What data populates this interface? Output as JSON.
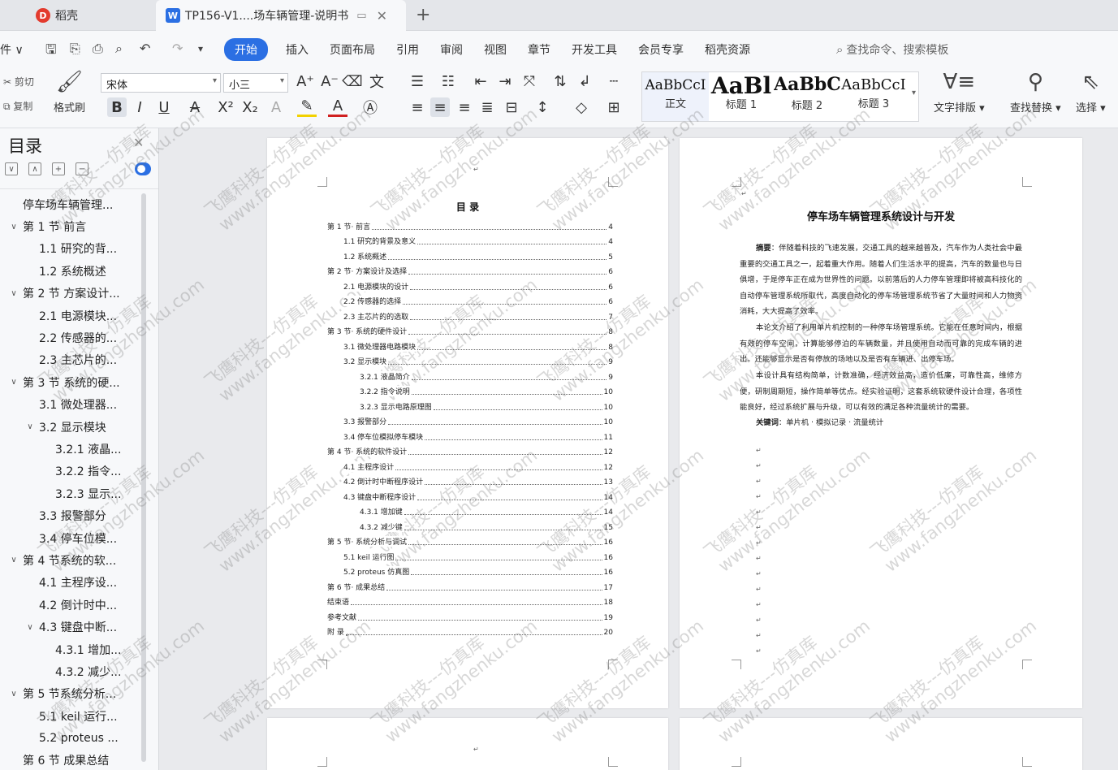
{
  "tabs": {
    "home": "稻壳",
    "home_icon": "docer-logo-icon",
    "doc": "TP156-V1....场车辆管理-说明书",
    "doc_icon": "wps-writer-icon",
    "add": "+"
  },
  "menubar": {
    "file": "件 ∨",
    "tabs": [
      "开始",
      "插入",
      "页面布局",
      "引用",
      "审阅",
      "视图",
      "章节",
      "开发工具",
      "会员专享",
      "稻壳资源"
    ],
    "search": "查找命令、搜索模板"
  },
  "ribbon": {
    "cut": "剪切",
    "copy": "复制",
    "format_painter": "格式刷",
    "font": "宋体",
    "size": "小三",
    "styles": [
      {
        "sample": "AaBbCcI",
        "name": "正文"
      },
      {
        "sample": "AaBl",
        "name": "标题 1"
      },
      {
        "sample": "AaBbC",
        "name": "标题 2"
      },
      {
        "sample": "AaBbCcI",
        "name": "标题 3"
      }
    ],
    "text_layout": "文字排版",
    "find_replace": "查找替换",
    "select": "选择"
  },
  "sidebar": {
    "title": "目录",
    "items": [
      {
        "label": "停车场车辆管理...",
        "level": 0,
        "chev": ""
      },
      {
        "label": "第 1 节  前言",
        "level": 0,
        "chev": "∨"
      },
      {
        "label": "1.1 研究的背...",
        "level": 1,
        "chev": ""
      },
      {
        "label": "1.2 系统概述",
        "level": 1,
        "chev": ""
      },
      {
        "label": "第 2 节  方案设计...",
        "level": 0,
        "chev": "∨"
      },
      {
        "label": "2.1 电源模块...",
        "level": 1,
        "chev": ""
      },
      {
        "label": "2.2 传感器的...",
        "level": 1,
        "chev": ""
      },
      {
        "label": "2.3 主芯片的...",
        "level": 1,
        "chev": ""
      },
      {
        "label": "第 3 节  系统的硬...",
        "level": 0,
        "chev": "∨"
      },
      {
        "label": "3.1 微处理器...",
        "level": 1,
        "chev": ""
      },
      {
        "label": "3.2 显示模块",
        "level": 1,
        "chev": "∨"
      },
      {
        "label": "3.2.1 液晶...",
        "level": 2,
        "chev": ""
      },
      {
        "label": "3.2.2 指令...",
        "level": 2,
        "chev": ""
      },
      {
        "label": "3.2.3 显示...",
        "level": 2,
        "chev": ""
      },
      {
        "label": "3.3 报警部分",
        "level": 1,
        "chev": ""
      },
      {
        "label": "3.4 停车位模...",
        "level": 1,
        "chev": ""
      },
      {
        "label": "第 4 节系统的软...",
        "level": 0,
        "chev": "∨"
      },
      {
        "label": "4.1 主程序设...",
        "level": 1,
        "chev": ""
      },
      {
        "label": "4.2 倒计时中...",
        "level": 1,
        "chev": ""
      },
      {
        "label": "4.3 键盘中断...",
        "level": 1,
        "chev": "∨"
      },
      {
        "label": "4.3.1 增加...",
        "level": 2,
        "chev": ""
      },
      {
        "label": "4.3.2 减少...",
        "level": 2,
        "chev": ""
      },
      {
        "label": "第 5 节系统分析...",
        "level": 0,
        "chev": "∨"
      },
      {
        "label": "5.1 keil 运行...",
        "level": 1,
        "chev": ""
      },
      {
        "label": "5.2 proteus ...",
        "level": 1,
        "chev": ""
      },
      {
        "label": "第 6 节  成果总结",
        "level": 0,
        "chev": ""
      }
    ]
  },
  "page1": {
    "heading": "目  录",
    "rows": [
      {
        "t": "第 1 节· 前言",
        "n": "4",
        "indent": 0
      },
      {
        "t": "1.1 研究的背景及意义",
        "n": "4",
        "indent": 1
      },
      {
        "t": "1.2 系统概述",
        "n": "5",
        "indent": 1
      },
      {
        "t": "第 2 节· 方案设计及选择",
        "n": "6",
        "indent": 0
      },
      {
        "t": "2.1 电源模块的设计",
        "n": "6",
        "indent": 1
      },
      {
        "t": "2.2 传感器的选择",
        "n": "6",
        "indent": 1
      },
      {
        "t": "2.3 主芯片的的选取",
        "n": "7",
        "indent": 1
      },
      {
        "t": "第 3 节· 系统的硬件设计",
        "n": "8",
        "indent": 0
      },
      {
        "t": "3.1 微处理器电路模块",
        "n": "8",
        "indent": 1
      },
      {
        "t": "3.2 显示模块",
        "n": "9",
        "indent": 1
      },
      {
        "t": "3.2.1 液晶简介",
        "n": "9",
        "indent": 2
      },
      {
        "t": "3.2.2 指令说明",
        "n": "10",
        "indent": 2
      },
      {
        "t": "3.2.3 显示电路原理图",
        "n": "10",
        "indent": 2
      },
      {
        "t": "3.3 报警部分",
        "n": "10",
        "indent": 1
      },
      {
        "t": "3.4 停车位模拟停车模块",
        "n": "11",
        "indent": 1
      },
      {
        "t": "第 4 节· 系统的软件设计",
        "n": "12",
        "indent": 0
      },
      {
        "t": "4.1 主程序设计",
        "n": "12",
        "indent": 1
      },
      {
        "t": "4.2 倒计时中断程序设计",
        "n": "13",
        "indent": 1
      },
      {
        "t": "4.3 键盘中断程序设计",
        "n": "14",
        "indent": 1
      },
      {
        "t": "4.3.1 增加键",
        "n": "14",
        "indent": 2
      },
      {
        "t": "4.3.2 减少键",
        "n": "15",
        "indent": 2
      },
      {
        "t": "第 5 节· 系统分析与调试",
        "n": "16",
        "indent": 0
      },
      {
        "t": "5.1 keil 运行图",
        "n": "16",
        "indent": 1
      },
      {
        "t": "5.2 proteus 仿真图",
        "n": "16",
        "indent": 1
      },
      {
        "t": "第 6 节· 成果总结",
        "n": "17",
        "indent": 0
      },
      {
        "t": "结束语",
        "n": "18",
        "indent": 0
      },
      {
        "t": "参考文献",
        "n": "19",
        "indent": 0
      },
      {
        "t": "附  录",
        "n": "20",
        "indent": 0
      }
    ]
  },
  "page2": {
    "title": "停车场车辆管理系统设计与开发",
    "abstract_label": "摘要",
    "abstract": "：伴随着科技的飞速发展，交通工具的越来越普及，汽车作为人类社会中最重要的交通工具之一，起着重大作用。随着人们生活水平的提高，汽车的数量也与日俱增，于是停车正在成为世界性的问题。以前落后的人力停车管理即将被高科技化的自动停车管理系统所取代，高度自动化的停车场管理系统节省了大量时间和人力物资消耗，大大提高了效率。",
    "para2": "本论文介绍了利用单片机控制的一种停车场管理系统。它能在任意时间内，根据有效的停车空间，计算能够停泊的车辆数量，并且使用自动而可靠的完成车辆的进出。还能够显示是否有停放的场地以及是否有车辆进、出停车场。",
    "para3": "本设计具有结构简单，计数准确，经济效益高，造价低廉，可靠性高，维修方便，研制周期短，操作简单等优点。经实验证明，这套系统软硬件设计合理，各项性能良好，经过系统扩展与升级，可以有效的满足各种流量统计的需要。",
    "keywords_label": "关键词",
    "keywords": "：单片机 · 模拟记录 · 流量统计"
  },
  "watermark": {
    "text": "飞鹰科技---仿真库",
    "url": "www.fangzhenku.com"
  }
}
